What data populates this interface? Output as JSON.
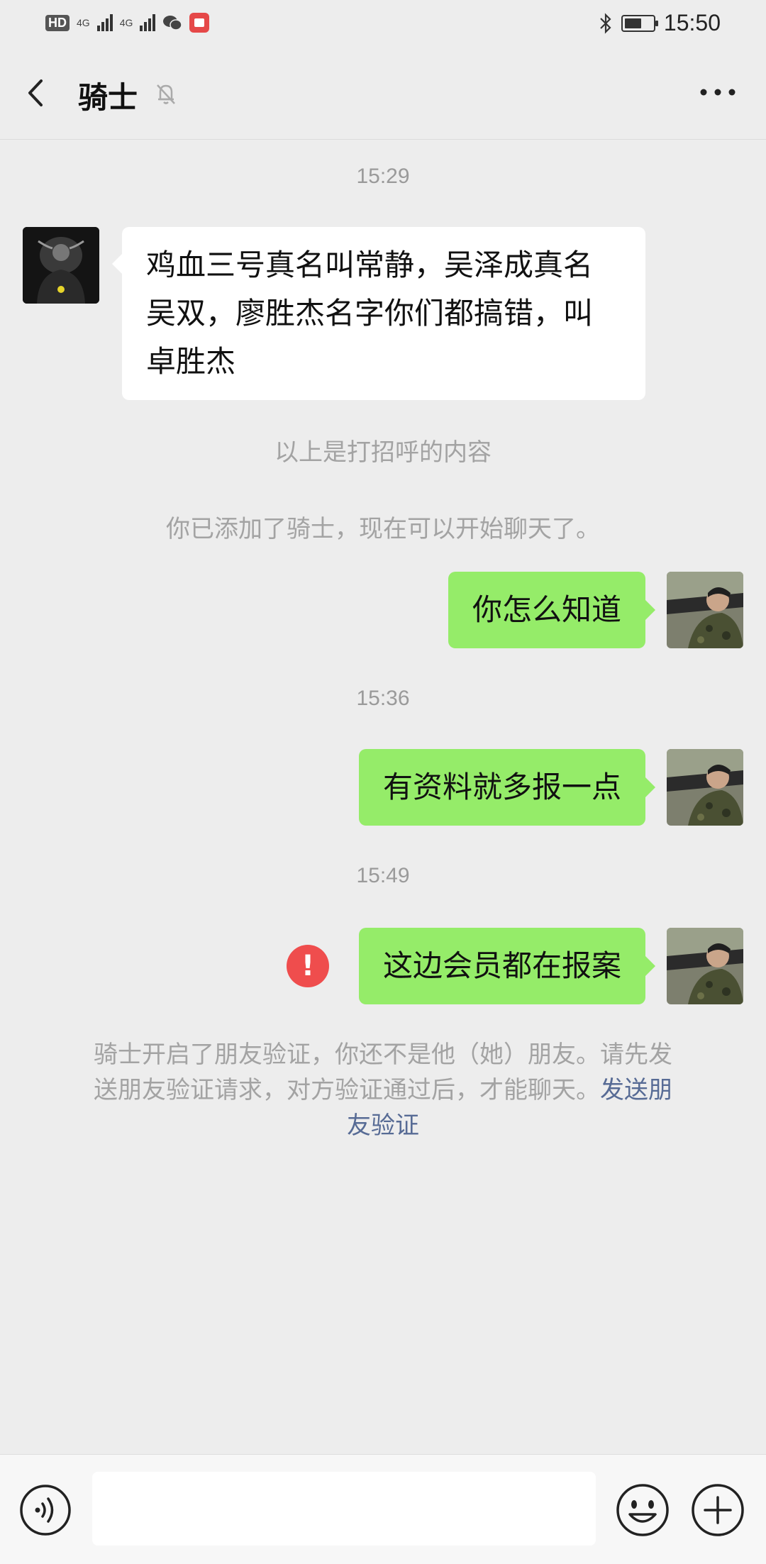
{
  "status_bar": {
    "hd": "HD",
    "net1": "4G",
    "net2": "4G",
    "time": "15:50",
    "battery_level": 0.6
  },
  "header": {
    "title": "骑士"
  },
  "messages": [
    {
      "type": "time",
      "text": "15:29"
    },
    {
      "type": "incoming",
      "lines": [
        "鸡血三号真名叫常静，吴泽成真名",
        "吴双，廖胜杰名字你们都搞错，叫",
        "卓胜杰"
      ]
    },
    {
      "type": "system",
      "text": "以上是打招呼的内容"
    },
    {
      "type": "system",
      "text": "你已添加了骑士，现在可以开始聊天了。"
    },
    {
      "type": "outgoing",
      "text": "你怎么知道"
    },
    {
      "type": "time",
      "text": "15:36"
    },
    {
      "type": "outgoing",
      "text": "有资料就多报一点"
    },
    {
      "type": "time",
      "text": "15:49"
    },
    {
      "type": "outgoing",
      "text": "这边会员都在报案",
      "failed": true,
      "fail_mark": "!"
    }
  ],
  "notice": {
    "lines": [
      "骑士开启了朋友验证，你还不是他（她）朋友。请先发",
      "送朋友验证请求，对方验证通过后，才能聊天。"
    ],
    "link_part1": "发送朋",
    "link_part2": "友验证"
  },
  "colors": {
    "background": "#ededed",
    "outgoing_bubble": "#95ec69",
    "incoming_bubble": "#ffffff",
    "link": "#576b95",
    "error": "#ef4d4d"
  },
  "icons": [
    "back-arrow-icon",
    "mute-bell-icon",
    "more-dots-icon",
    "voice-icon",
    "emoji-icon",
    "plus-icon"
  ]
}
